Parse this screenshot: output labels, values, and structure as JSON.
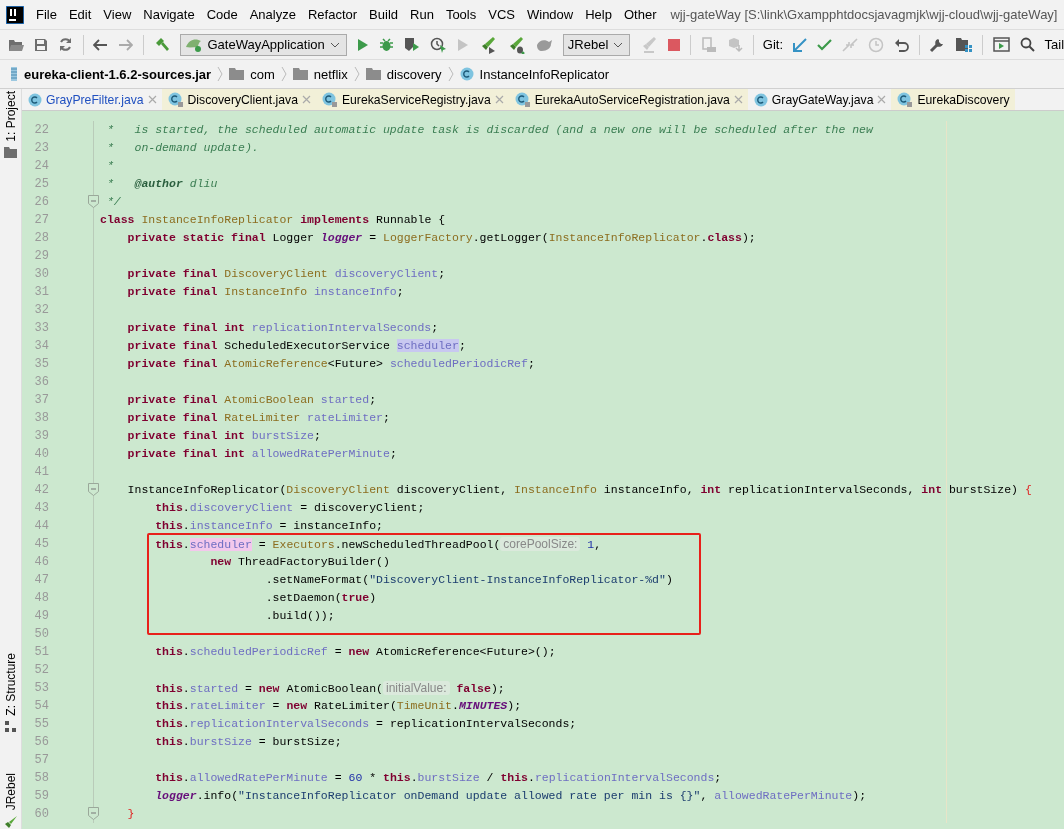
{
  "menu": [
    "File",
    "Edit",
    "View",
    "Navigate",
    "Code",
    "Analyze",
    "Refactor",
    "Build",
    "Run",
    "Tools",
    "VCS",
    "Window",
    "Help",
    "Other"
  ],
  "window": {
    "title": "wjj-gateWay [S:\\link\\Gxampphtdocsjavagmjk\\wjj-cloud\\wjj-gateWay]"
  },
  "toolbar": {
    "run_config": "GateWayApplication",
    "jrebel_config": "JRebel",
    "git_label": "Git:",
    "tail": "Tail"
  },
  "breadcrumbs": [
    {
      "kind": "jar",
      "label": "eureka-client-1.6.2-sources.jar"
    },
    {
      "kind": "folder",
      "label": "com"
    },
    {
      "kind": "folder",
      "label": "netflix"
    },
    {
      "kind": "folder",
      "label": "discovery"
    },
    {
      "kind": "class",
      "label": "InstanceInfoReplicator"
    }
  ],
  "tabs": [
    {
      "label": "GrayPreFilter.java",
      "library": false,
      "modified": true
    },
    {
      "label": "DiscoveryClient.java",
      "library": true,
      "modified": false
    },
    {
      "label": "EurekaServiceRegistry.java",
      "library": true,
      "modified": false
    },
    {
      "label": "EurekaAutoServiceRegistration.java",
      "library": true,
      "modified": false
    },
    {
      "label": "GrayGateWay.java",
      "library": false,
      "modified": false
    },
    {
      "label": "EurekaDiscovery",
      "library": true,
      "modified": false
    }
  ],
  "side_tools": [
    {
      "kind": "project",
      "label": "1: Project"
    },
    {
      "kind": "structure",
      "label": "Z: Structure"
    },
    {
      "kind": "jrebel",
      "label": "JRebel"
    }
  ],
  "editor": {
    "lines": [
      {
        "number": "22",
        "tokens": [
          {
            "kind": "comment",
            "text": " *   is started, the scheduled automatic update task is discarded (and a new one will be scheduled after the new"
          }
        ]
      },
      {
        "number": "23",
        "tokens": [
          {
            "kind": "comment",
            "text": " *   on-demand update)."
          }
        ]
      },
      {
        "number": "24",
        "tokens": [
          {
            "kind": "comment",
            "text": " *"
          }
        ]
      },
      {
        "number": "25",
        "tokens": [
          {
            "kind": "comment",
            "text": " *   "
          },
          {
            "kind": "tag",
            "text": "@author"
          },
          {
            "kind": "comment",
            "text": " dliu"
          }
        ]
      },
      {
        "number": "26",
        "fold": true,
        "tokens": [
          {
            "kind": "comment",
            "text": " */"
          }
        ]
      },
      {
        "number": "27",
        "tokens": [
          {
            "kind": "kw",
            "text": "class"
          },
          {
            "kind": "type",
            "text": " InstanceInfoReplicator "
          },
          {
            "kind": "kw",
            "text": "implements"
          },
          {
            "kind": "plain",
            "text": " Runnable {"
          }
        ]
      },
      {
        "number": "28",
        "tokens": [
          {
            "kind": "kw",
            "text": "    private static final"
          },
          {
            "kind": "plain",
            "text": " Logger "
          },
          {
            "kind": "static",
            "text": "logger"
          },
          {
            "kind": "plain",
            "text": " = "
          },
          {
            "kind": "type",
            "text": "LoggerFactory"
          },
          {
            "kind": "plain",
            "text": ".getLogger("
          },
          {
            "kind": "type",
            "text": "InstanceInfoReplicator"
          },
          {
            "kind": "plain",
            "text": "."
          },
          {
            "kind": "kw",
            "text": "class"
          },
          {
            "kind": "plain",
            "text": ");"
          }
        ]
      },
      {
        "number": "29"
      },
      {
        "number": "30",
        "tokens": [
          {
            "kind": "kw",
            "text": "    private final"
          },
          {
            "kind": "type",
            "text": " DiscoveryClient "
          },
          {
            "kind": "field",
            "text": "discoveryClient"
          },
          {
            "kind": "plain",
            "text": ";"
          }
        ]
      },
      {
        "number": "31",
        "tokens": [
          {
            "kind": "kw",
            "text": "    private final"
          },
          {
            "kind": "type",
            "text": " InstanceInfo "
          },
          {
            "kind": "field",
            "text": "instanceInfo"
          },
          {
            "kind": "plain",
            "text": ";"
          }
        ]
      },
      {
        "number": "32"
      },
      {
        "number": "33",
        "tokens": [
          {
            "kind": "kw",
            "text": "    private final int"
          },
          {
            "kind": "field",
            "text": " replicationIntervalSeconds"
          },
          {
            "kind": "plain",
            "text": ";"
          }
        ]
      },
      {
        "number": "34",
        "tokens": [
          {
            "kind": "kw",
            "text": "    private final"
          },
          {
            "kind": "plain",
            "text": " ScheduledExecutorService "
          },
          {
            "kind": "field",
            "text": "scheduler",
            "read_highlight": true
          },
          {
            "kind": "plain",
            "text": ";"
          }
        ]
      },
      {
        "number": "35",
        "tokens": [
          {
            "kind": "kw",
            "text": "    private final"
          },
          {
            "kind": "type",
            "text": " AtomicReference"
          },
          {
            "kind": "plain",
            "text": "<Future> "
          },
          {
            "kind": "field",
            "text": "scheduledPeriodicRef"
          },
          {
            "kind": "plain",
            "text": ";"
          }
        ]
      },
      {
        "number": "36"
      },
      {
        "number": "37",
        "tokens": [
          {
            "kind": "kw",
            "text": "    private final"
          },
          {
            "kind": "type",
            "text": " AtomicBoolean "
          },
          {
            "kind": "field",
            "text": "started"
          },
          {
            "kind": "plain",
            "text": ";"
          }
        ]
      },
      {
        "number": "38",
        "tokens": [
          {
            "kind": "kw",
            "text": "    private final"
          },
          {
            "kind": "type",
            "text": " RateLimiter "
          },
          {
            "kind": "field",
            "text": "rateLimiter"
          },
          {
            "kind": "plain",
            "text": ";"
          }
        ]
      },
      {
        "number": "39",
        "tokens": [
          {
            "kind": "kw",
            "text": "    private final int"
          },
          {
            "kind": "field",
            "text": " burstSize"
          },
          {
            "kind": "plain",
            "text": ";"
          }
        ]
      },
      {
        "number": "40",
        "tokens": [
          {
            "kind": "kw",
            "text": "    private final int"
          },
          {
            "kind": "field",
            "text": " allowedRatePerMinute"
          },
          {
            "kind": "plain",
            "text": ";"
          }
        ]
      },
      {
        "number": "41"
      },
      {
        "number": "42",
        "fold": true,
        "tokens": [
          {
            "kind": "plain",
            "text": "    InstanceInfoReplicator("
          },
          {
            "kind": "type",
            "text": "DiscoveryClient"
          },
          {
            "kind": "plain",
            "text": " discoveryClient, "
          },
          {
            "kind": "type",
            "text": "InstanceInfo"
          },
          {
            "kind": "plain",
            "text": " instanceInfo, "
          },
          {
            "kind": "kw",
            "text": "int"
          },
          {
            "kind": "plain",
            "text": " replicationIntervalSeconds, "
          },
          {
            "kind": "kw",
            "text": "int"
          },
          {
            "kind": "plain",
            "text": " burstSize) "
          },
          {
            "kind": "brace",
            "text": "{"
          }
        ]
      },
      {
        "number": "43",
        "tokens": [
          {
            "kind": "kw",
            "text": "        this"
          },
          {
            "kind": "plain",
            "text": "."
          },
          {
            "kind": "field",
            "text": "discoveryClient"
          },
          {
            "kind": "plain",
            "text": " = discoveryClient;"
          }
        ]
      },
      {
        "number": "44",
        "tokens": [
          {
            "kind": "kw",
            "text": "        this"
          },
          {
            "kind": "plain",
            "text": "."
          },
          {
            "kind": "field",
            "text": "instanceInfo"
          },
          {
            "kind": "plain",
            "text": " = instanceInfo;"
          }
        ]
      },
      {
        "number": "45",
        "boxed": true,
        "tokens": [
          {
            "kind": "kw",
            "text": "        this"
          },
          {
            "kind": "plain",
            "text": "."
          },
          {
            "kind": "field",
            "text": "scheduler",
            "write_highlight": true
          },
          {
            "kind": "plain",
            "text": " = "
          },
          {
            "kind": "type",
            "text": "Executors"
          },
          {
            "kind": "plain",
            "text": ".newScheduledThreadPool("
          },
          {
            "kind": "hint",
            "text": "corePoolSize:"
          },
          {
            "kind": "num",
            "text": " 1"
          },
          {
            "kind": "plain",
            "text": ","
          }
        ]
      },
      {
        "number": "46",
        "boxed": true,
        "tokens": [
          {
            "kind": "kw",
            "text": "                new"
          },
          {
            "kind": "plain",
            "text": " ThreadFactoryBuilder()"
          }
        ]
      },
      {
        "number": "47",
        "boxed": true,
        "tokens": [
          {
            "kind": "plain",
            "text": "                        .setNameFormat("
          },
          {
            "kind": "str",
            "text": "\"DiscoveryClient-InstanceInfoReplicator-%d\""
          },
          {
            "kind": "plain",
            "text": ")"
          }
        ]
      },
      {
        "number": "48",
        "boxed": true,
        "tokens": [
          {
            "kind": "plain",
            "text": "                        .setDaemon("
          },
          {
            "kind": "kw",
            "text": "true"
          },
          {
            "kind": "plain",
            "text": ")"
          }
        ]
      },
      {
        "number": "49",
        "boxed": true,
        "tokens": [
          {
            "kind": "plain",
            "text": "                        .build());"
          }
        ]
      },
      {
        "number": "50"
      },
      {
        "number": "51",
        "tokens": [
          {
            "kind": "kw",
            "text": "        this"
          },
          {
            "kind": "plain",
            "text": "."
          },
          {
            "kind": "field",
            "text": "scheduledPeriodicRef"
          },
          {
            "kind": "plain",
            "text": " = "
          },
          {
            "kind": "kw",
            "text": "new"
          },
          {
            "kind": "plain",
            "text": " AtomicReference<Future>();"
          }
        ]
      },
      {
        "number": "52"
      },
      {
        "number": "53",
        "tokens": [
          {
            "kind": "kw",
            "text": "        this"
          },
          {
            "kind": "plain",
            "text": "."
          },
          {
            "kind": "field",
            "text": "started"
          },
          {
            "kind": "plain",
            "text": " = "
          },
          {
            "kind": "kw",
            "text": "new"
          },
          {
            "kind": "plain",
            "text": " AtomicBoolean("
          },
          {
            "kind": "hint",
            "text": "initialValue:"
          },
          {
            "kind": "kw",
            "text": " false"
          },
          {
            "kind": "plain",
            "text": ");"
          }
        ]
      },
      {
        "number": "54",
        "tokens": [
          {
            "kind": "kw",
            "text": "        this"
          },
          {
            "kind": "plain",
            "text": "."
          },
          {
            "kind": "field",
            "text": "rateLimiter"
          },
          {
            "kind": "plain",
            "text": " = "
          },
          {
            "kind": "kw",
            "text": "new"
          },
          {
            "kind": "plain",
            "text": " RateLimiter("
          },
          {
            "kind": "type",
            "text": "TimeUnit"
          },
          {
            "kind": "plain",
            "text": "."
          },
          {
            "kind": "static",
            "text": "MINUTES"
          },
          {
            "kind": "plain",
            "text": ");"
          }
        ]
      },
      {
        "number": "55",
        "tokens": [
          {
            "kind": "kw",
            "text": "        this"
          },
          {
            "kind": "plain",
            "text": "."
          },
          {
            "kind": "field",
            "text": "replicationIntervalSeconds"
          },
          {
            "kind": "plain",
            "text": " = replicationIntervalSeconds;"
          }
        ]
      },
      {
        "number": "56",
        "tokens": [
          {
            "kind": "kw",
            "text": "        this"
          },
          {
            "kind": "plain",
            "text": "."
          },
          {
            "kind": "field",
            "text": "burstSize"
          },
          {
            "kind": "plain",
            "text": " = burstSize;"
          }
        ]
      },
      {
        "number": "57"
      },
      {
        "number": "58",
        "tokens": [
          {
            "kind": "kw",
            "text": "        this"
          },
          {
            "kind": "plain",
            "text": "."
          },
          {
            "kind": "field",
            "text": "allowedRatePerMinute"
          },
          {
            "kind": "plain",
            "text": " = "
          },
          {
            "kind": "num",
            "text": "60"
          },
          {
            "kind": "plain",
            "text": " * "
          },
          {
            "kind": "kw",
            "text": "this"
          },
          {
            "kind": "plain",
            "text": "."
          },
          {
            "kind": "field",
            "text": "burstSize"
          },
          {
            "kind": "plain",
            "text": " / "
          },
          {
            "kind": "kw",
            "text": "this"
          },
          {
            "kind": "plain",
            "text": "."
          },
          {
            "kind": "field",
            "text": "replicationIntervalSeconds"
          },
          {
            "kind": "plain",
            "text": ";"
          }
        ]
      },
      {
        "number": "59",
        "tokens": [
          {
            "kind": "static",
            "text": "        logger"
          },
          {
            "kind": "plain",
            "text": ".info("
          },
          {
            "kind": "str",
            "text": "\"InstanceInfoReplicator onDemand update allowed rate per min is {}\""
          },
          {
            "kind": "plain",
            "text": ", "
          },
          {
            "kind": "field",
            "text": "allowedRatePerMinute"
          },
          {
            "kind": "plain",
            "text": ");"
          }
        ]
      },
      {
        "number": "60",
        "fold": true,
        "tokens": [
          {
            "kind": "brace",
            "text": "    }"
          }
        ]
      }
    ]
  }
}
